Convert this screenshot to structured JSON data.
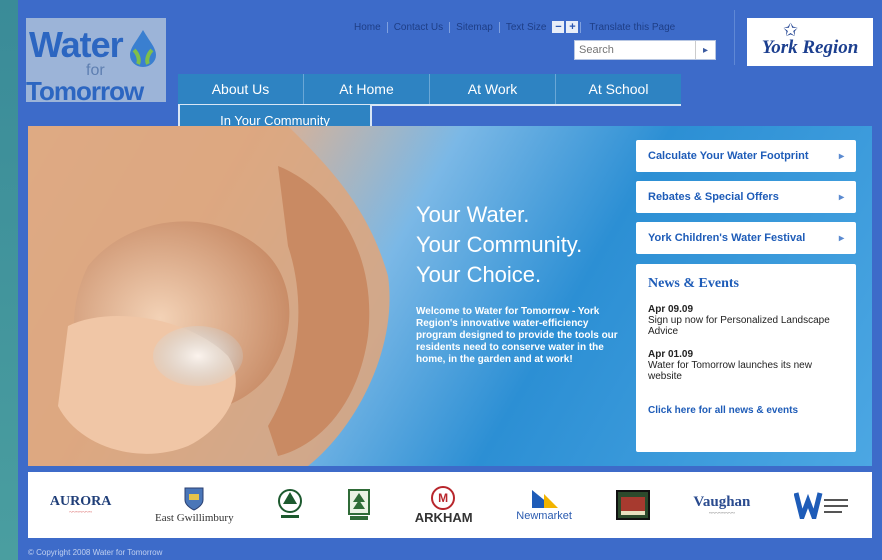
{
  "logo": {
    "line1": "Water",
    "line2": "for",
    "line3": "Tomorrow"
  },
  "utility": {
    "links": [
      "Home",
      "Contact Us",
      "Sitemap"
    ],
    "text_size_label": "Text Size",
    "minus": "−",
    "plus": "+",
    "translate": "Translate this Page"
  },
  "search": {
    "placeholder": "Search",
    "go": "▸"
  },
  "york_logo": "York Region",
  "nav": {
    "items": [
      "About Us",
      "At Home",
      "At Work",
      "At School"
    ],
    "sub_item": "In Your Community"
  },
  "hero": {
    "tagline": [
      "Your Water.",
      "Your Community.",
      "Your Choice."
    ],
    "intro": "Welcome to Water for Tomorrow - York Region's innovative water-efficiency program designed to provide the tools our residents need to conserve water in the home, in the garden and at work!"
  },
  "sidebar_buttons": [
    {
      "label": "Calculate Your Water Footprint",
      "chev": "▸"
    },
    {
      "label": "Rebates & Special Offers",
      "chev": "▸"
    },
    {
      "label": "York Children's Water Festival",
      "chev": "▸"
    }
  ],
  "news": {
    "title": "News & Events",
    "items": [
      {
        "date": "Apr 09.09",
        "text": "Sign up now for Personalized Landscape Advice"
      },
      {
        "date": "Apr 01.09",
        "text": "Water for Tomorrow launches its new website"
      }
    ],
    "all_link": "Click here for all news & events"
  },
  "partners": {
    "aurora": "AURORA",
    "east_gwillimbury": "East Gwillimbury",
    "markham": "ARKHAM",
    "markham_m": "M",
    "newmarket": "Newmarket",
    "vaughan": "Vaughan"
  },
  "footer": "© Copyright 2008 Water for Tomorrow"
}
